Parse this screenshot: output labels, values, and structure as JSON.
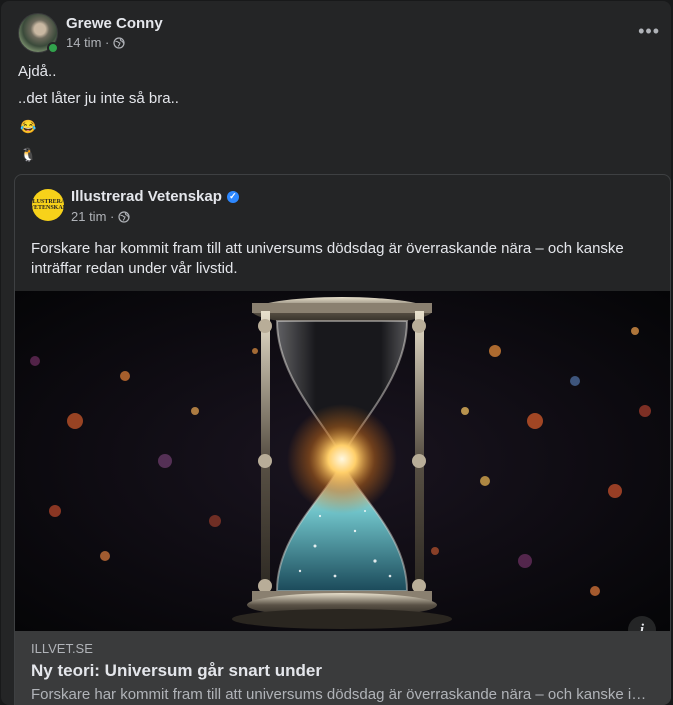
{
  "post": {
    "author": "Grewe Conny",
    "time": "14 tim ·",
    "privacy_icon": "globe-icon",
    "lines": [
      "Ajdå..",
      "..det låter ju inte så bra.."
    ],
    "emojis": [
      "😂",
      "🐧"
    ]
  },
  "shared": {
    "page_name": "Illustrerad Vetenskap",
    "verified_icon": "verified-badge-icon",
    "time": "21 tim ·",
    "logo_text": "ILLUSTRERAD VETENSKAP",
    "text": "Forskare har kommit fram till att universums dödsdag är överraskande nära – och kanske inträffar redan under vår livstid.",
    "image_alt": "hourglass-with-galaxy",
    "link": {
      "domain": "ILLVET.SE",
      "title": "Ny teori: Universum går snart under",
      "description": "Forskare har kommit fram till att universums dödsdag är överraskande nära – och kanske inträffar redan under vår livstid."
    }
  },
  "colors": {
    "background": "#18191a",
    "card": "#242526",
    "online": "#31a24c",
    "verified": "#2d88ff",
    "logo_yellow": "#f7d21a"
  }
}
